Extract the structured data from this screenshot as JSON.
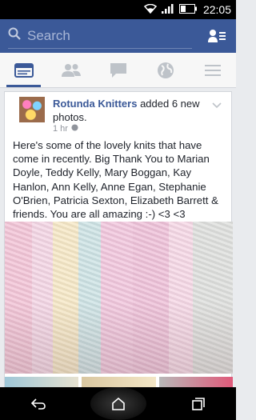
{
  "status_bar": {
    "time": "22:05"
  },
  "header": {
    "search_placeholder": "Search",
    "brand_color": "#3b5998"
  },
  "tabs": [
    {
      "name": "news-feed",
      "icon": "news-feed-icon",
      "active": true
    },
    {
      "name": "friends",
      "icon": "friends-icon",
      "active": false
    },
    {
      "name": "messages",
      "icon": "chat-bubble-icon",
      "active": false
    },
    {
      "name": "notifications",
      "icon": "globe-icon",
      "active": false
    },
    {
      "name": "more",
      "icon": "menu-icon",
      "active": false
    }
  ],
  "post": {
    "author": "Rotunda Knitters",
    "action": "added 6 new photos.",
    "time": "1 hr",
    "body": "Here's some of the lovely knits that have come in recently. Big Thank You to Marian Doyle, Teddy Kelly, Mary Boggan, Kay Hanlon, Ann Kelly, Anne Egan, Stephanie O'Brien, Patricia Sexton, Elizabeth Barrett & friends. You are all amazing :-) <3 <3"
  }
}
